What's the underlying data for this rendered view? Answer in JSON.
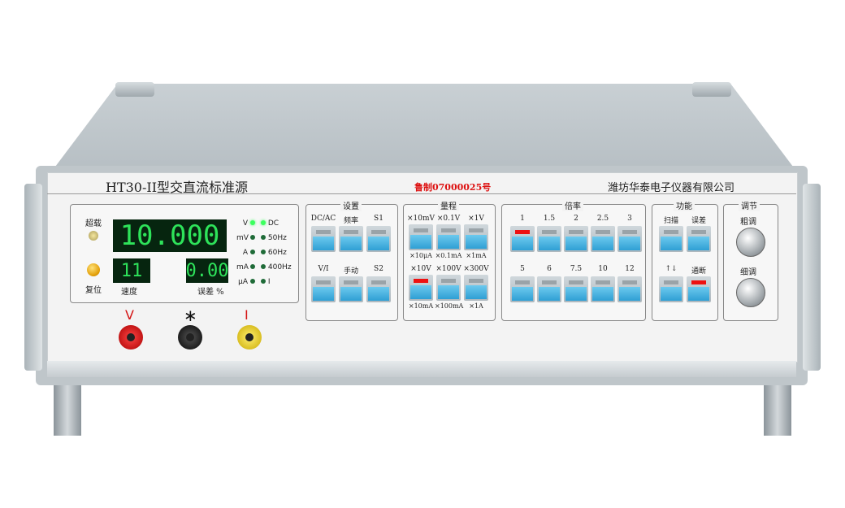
{
  "instrument": {
    "title": "HT30-II型交直流标准源",
    "license": "鲁制07000025号",
    "manufacturer": "潍坊华泰电子仪器有限公司"
  },
  "display": {
    "main_reading": "10.000",
    "speed_reading": "11",
    "error_reading": "0.00",
    "overload_label": "超载",
    "reset_label": "复位",
    "speed_label": "速度",
    "error_label": "误差 %",
    "unit_indicators": [
      {
        "label": "V",
        "on": true
      },
      {
        "label": "mV",
        "on": false
      },
      {
        "label": "A",
        "on": false
      },
      {
        "label": "mA",
        "on": false
      },
      {
        "label": "μA",
        "on": false
      }
    ],
    "mode_indicators": [
      {
        "label": "DC",
        "on": true
      },
      {
        "label": "50Hz",
        "on": false
      },
      {
        "label": "60Hz",
        "on": false
      },
      {
        "label": "400Hz",
        "on": false
      },
      {
        "label": "I",
        "on": false
      }
    ]
  },
  "groups": {
    "settings": {
      "title": "设置",
      "row1": [
        "DC/AC",
        "频率",
        "S1"
      ],
      "row2": [
        "V/I",
        "手动",
        "S2"
      ]
    },
    "range": {
      "title": "量程",
      "row1_top": [
        "×10mV",
        "×0.1V",
        "×1V"
      ],
      "row1_bottom": [
        "×10μA",
        "×0.1mA",
        "×1mA"
      ],
      "row2_top": [
        "×10V",
        "×100V",
        "×300V"
      ],
      "row2_bottom": [
        "×10mA",
        "×100mA",
        "×1A"
      ],
      "active": "×10V"
    },
    "multiplier": {
      "title": "倍率",
      "row1": [
        "1",
        "1.5",
        "2",
        "2.5",
        "3"
      ],
      "row2": [
        "5",
        "6",
        "7.5",
        "10",
        "12"
      ],
      "active": "1"
    },
    "function": {
      "title": "功能",
      "row1": [
        "扫描",
        "误差"
      ],
      "row2": [
        "↑↓",
        "通断"
      ],
      "active": "通断"
    },
    "adjust": {
      "title": "调节",
      "coarse": "粗调",
      "fine": "细调"
    }
  },
  "terminals": [
    {
      "label": "V",
      "color": "#d41414"
    },
    {
      "label": "∗",
      "color": "#111111"
    },
    {
      "label": "I",
      "color": "#e8cc10"
    }
  ]
}
